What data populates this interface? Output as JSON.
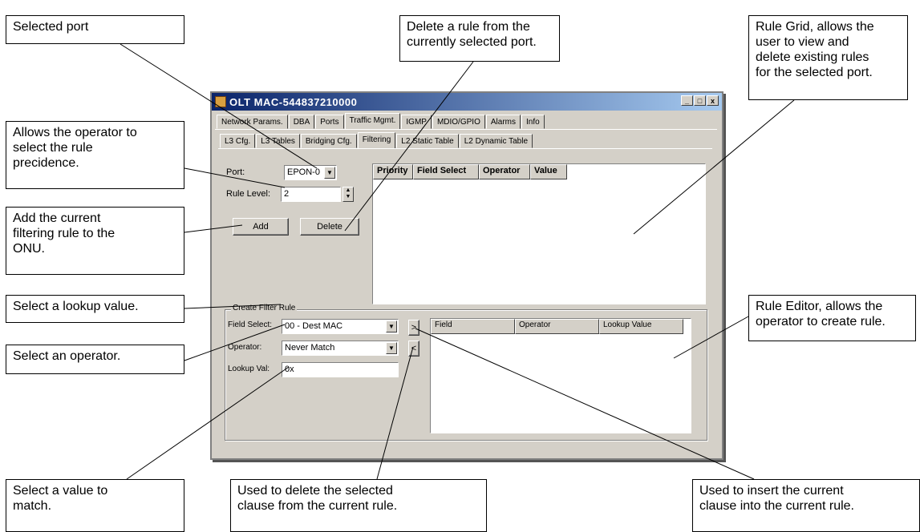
{
  "callouts": {
    "selected_port": "Selected port",
    "delete_rule": "Delete a rule from the\ncurrently selected port.",
    "rule_grid": "Rule Grid, allows the\nuser to view and\ndelete existing rules\nfor the selected port.",
    "precedence": "Allows the operator to\nselect the rule\nprecidence.",
    "add_rule": "Add the current\nfiltering rule to the\nONU.",
    "lookup": "Select a lookup value.",
    "operator": "Select an operator.",
    "rule_editor": "Rule Editor, allows the\noperator to create rule.",
    "value_match": "Select a value to\nmatch.",
    "delete_clause": "Used to delete the selected\nclause from the current rule.",
    "insert_clause": "Used to insert the current\nclause into the current rule."
  },
  "window": {
    "title": "OLT MAC-544837210000",
    "buttons": [
      "_",
      "□",
      "x"
    ]
  },
  "tabs_main": [
    "Network Params.",
    "DBA",
    "Ports",
    "Traffic Mgmt.",
    "IGMP",
    "MDIO/GPIO",
    "Alarms",
    "Info"
  ],
  "tabs_sub": [
    "L3 Cfg.",
    "L3 Tables",
    "Bridging Cfg.",
    "Filtering",
    "L2 Static Table",
    "L2 Dynamic Table"
  ],
  "form": {
    "port_label": "Port:",
    "port_value": "EPON-0",
    "rule_level_label": "Rule Level:",
    "rule_level_value": "2",
    "add_label": "Add",
    "delete_label": "Delete"
  },
  "rule_grid": {
    "columns": [
      "Priority",
      "Field Select",
      "Operator",
      "Value"
    ]
  },
  "filter_group": {
    "title": "Create Filter Rule",
    "field_select_label": "Field Select:",
    "field_select_value": "00 - Dest MAC",
    "operator_label": "Operator:",
    "operator_value": "Never Match",
    "lookup_label": "Lookup Val:",
    "lookup_value": "0x",
    "insert_btn": ">",
    "remove_btn": "<"
  },
  "editor_grid": {
    "columns": [
      "Field",
      "Operator",
      "Lookup Value"
    ]
  }
}
